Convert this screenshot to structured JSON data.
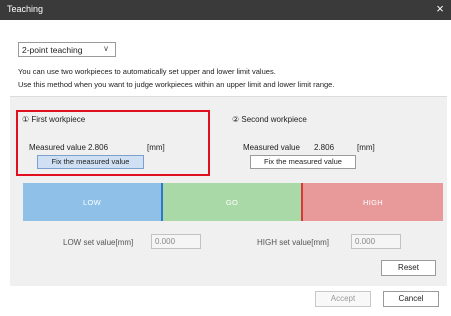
{
  "window": {
    "title": "Teaching",
    "close_icon": "×"
  },
  "mode": {
    "selected": "2-point teaching",
    "chevron": "∨"
  },
  "description": {
    "line1": "You can use two workpieces to automatically set upper and lower limit values.",
    "line2": "Use this method when you want to judge workpieces within an upper limit and lower limit range."
  },
  "first_workpiece": {
    "title": "① First workpiece",
    "measured_label": "Measured value",
    "measured_value": "2.806",
    "unit": "[mm]",
    "fix_button": "Fix the measured value"
  },
  "second_workpiece": {
    "title": "② Second workpiece",
    "measured_label": "Measured value",
    "measured_value": "2.806",
    "unit": "[mm]",
    "fix_button": "Fix the measured value"
  },
  "range_bar": {
    "low": "LOW",
    "go": "GO",
    "high": "HIGH",
    "colors": {
      "low": "#8ec0e8",
      "go": "#a9d9a7",
      "high": "#e89a9a",
      "low_marker": "#3278c8",
      "high_marker": "#d83838"
    }
  },
  "low_set": {
    "label": "LOW set value[mm]",
    "value": "0.000"
  },
  "high_set": {
    "label": "HIGH set value[mm]",
    "value": "0.000"
  },
  "buttons": {
    "reset": "Reset",
    "accept": "Accept",
    "cancel": "Cancel"
  },
  "highlight_color": "#e01020"
}
